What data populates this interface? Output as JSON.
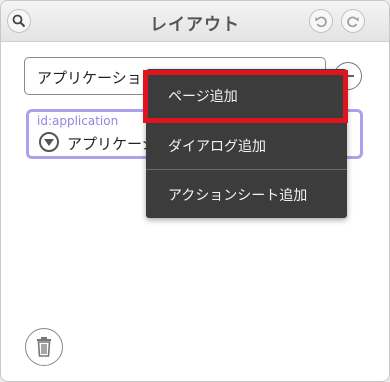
{
  "window": {
    "title": "レイアウト"
  },
  "icons": {
    "search": "search-icon",
    "undo": "undo-icon",
    "redo": "redo-icon",
    "add": "plus-icon",
    "toggle": "triangle-down-icon",
    "trash": "trash-icon"
  },
  "selector": {
    "selected": "アプリケーション"
  },
  "tree": {
    "node": {
      "id_text": "id:application",
      "label": "アプリケーション"
    }
  },
  "context_menu": {
    "items": [
      {
        "label": "ページ追加"
      },
      {
        "label": "ダイアログ追加"
      },
      {
        "label": "アクションシート追加"
      }
    ]
  },
  "colors": {
    "node_border": "#a9a3ee",
    "node_id_text": "#8f86e3",
    "menu_bg": "#3c3c3c",
    "highlight": "#e0141e"
  }
}
